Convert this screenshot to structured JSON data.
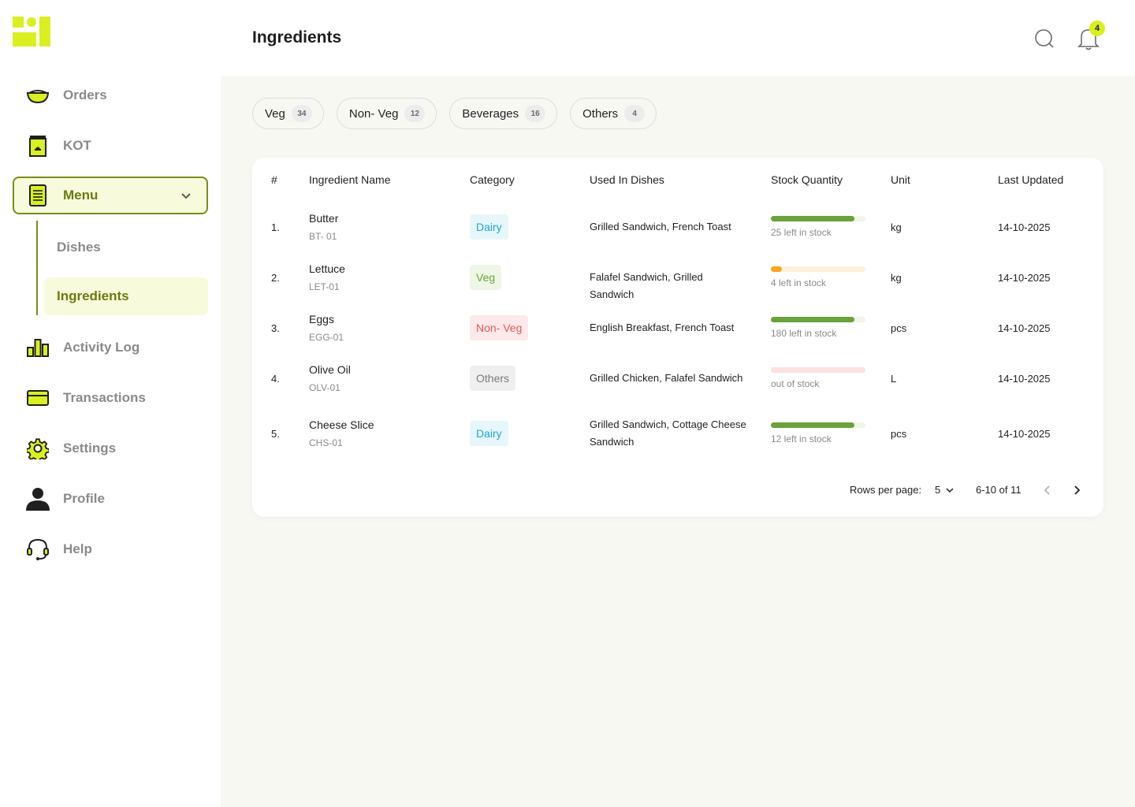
{
  "app": {
    "title": "Ingredients"
  },
  "header": {
    "notification_count": "4"
  },
  "sidebar": {
    "items": [
      {
        "label": "Orders",
        "icon": "bowl-icon"
      },
      {
        "label": "KOT",
        "icon": "kot-icon"
      },
      {
        "label": "Menu",
        "icon": "menu-doc-icon"
      },
      {
        "label": "Activity Log",
        "icon": "bar-chart-icon"
      },
      {
        "label": "Transactions",
        "icon": "card-icon"
      },
      {
        "label": "Settings",
        "icon": "gear-icon"
      },
      {
        "label": "Profile",
        "icon": "user-icon"
      },
      {
        "label": "Help",
        "icon": "headset-icon"
      }
    ],
    "submenu": [
      {
        "label": "Dishes"
      },
      {
        "label": "Ingredients"
      }
    ]
  },
  "filters": [
    {
      "label": "Veg",
      "count": "34"
    },
    {
      "label": "Non- Veg",
      "count": "12"
    },
    {
      "label": "Beverages",
      "count": "16"
    },
    {
      "label": "Others",
      "count": "4"
    }
  ],
  "table": {
    "headers": [
      "#",
      "Ingredient Name",
      "Category",
      "Used In Dishes",
      "Stock Quantity",
      "Unit",
      "Last Updated"
    ],
    "rows": [
      {
        "num": "1.",
        "name": "Butter",
        "code": "BT- 01",
        "category": "Dairy",
        "dishes": "Grilled Sandwich, French Toast",
        "stock_level": 0.88,
        "stock_text": "25 left in stock",
        "unit": "kg",
        "updated": "14-10-2025"
      },
      {
        "num": "2.",
        "name": "Lettuce",
        "code": "LET-01",
        "category": "Veg",
        "dishes": "Falafel Sandwich, Grilled Sandwich",
        "stock_level": 0.12,
        "stock_text": "4 left in stock",
        "unit": "kg",
        "updated": "14-10-2025"
      },
      {
        "num": "3.",
        "name": "Eggs",
        "code": "EGG-01",
        "category": "Non- Veg",
        "dishes": "English Breakfast, French Toast",
        "stock_level": 0.88,
        "stock_text": "180 left in stock",
        "unit": "pcs",
        "updated": "14-10-2025"
      },
      {
        "num": "4.",
        "name": "Olive Oil",
        "code": "OLV-01",
        "category": "Others",
        "dishes": "Grilled Chicken, Falafel Sandwich",
        "stock_level": 0,
        "stock_text": "out of stock",
        "unit": "L",
        "updated": "14-10-2025"
      },
      {
        "num": "5.",
        "name": "Cheese Slice",
        "code": "CHS-01",
        "category": "Dairy",
        "dishes": "Grilled Sandwich, Cottage Cheese Sandwich",
        "stock_level": 0.88,
        "stock_text": "12 left in stock",
        "unit": "pcs",
        "updated": "14-10-2025"
      }
    ]
  },
  "pagination": {
    "rows_per_page_label": "Rows per page:",
    "rows_per_page": "5",
    "range": "6-10 of 11"
  },
  "colors": {
    "accent": "#d9ef20",
    "brand_dark": "#7b8b1c",
    "stock_good": "#6aa23c",
    "stock_low": "#f5a623",
    "stock_out": "#fde0e2"
  }
}
